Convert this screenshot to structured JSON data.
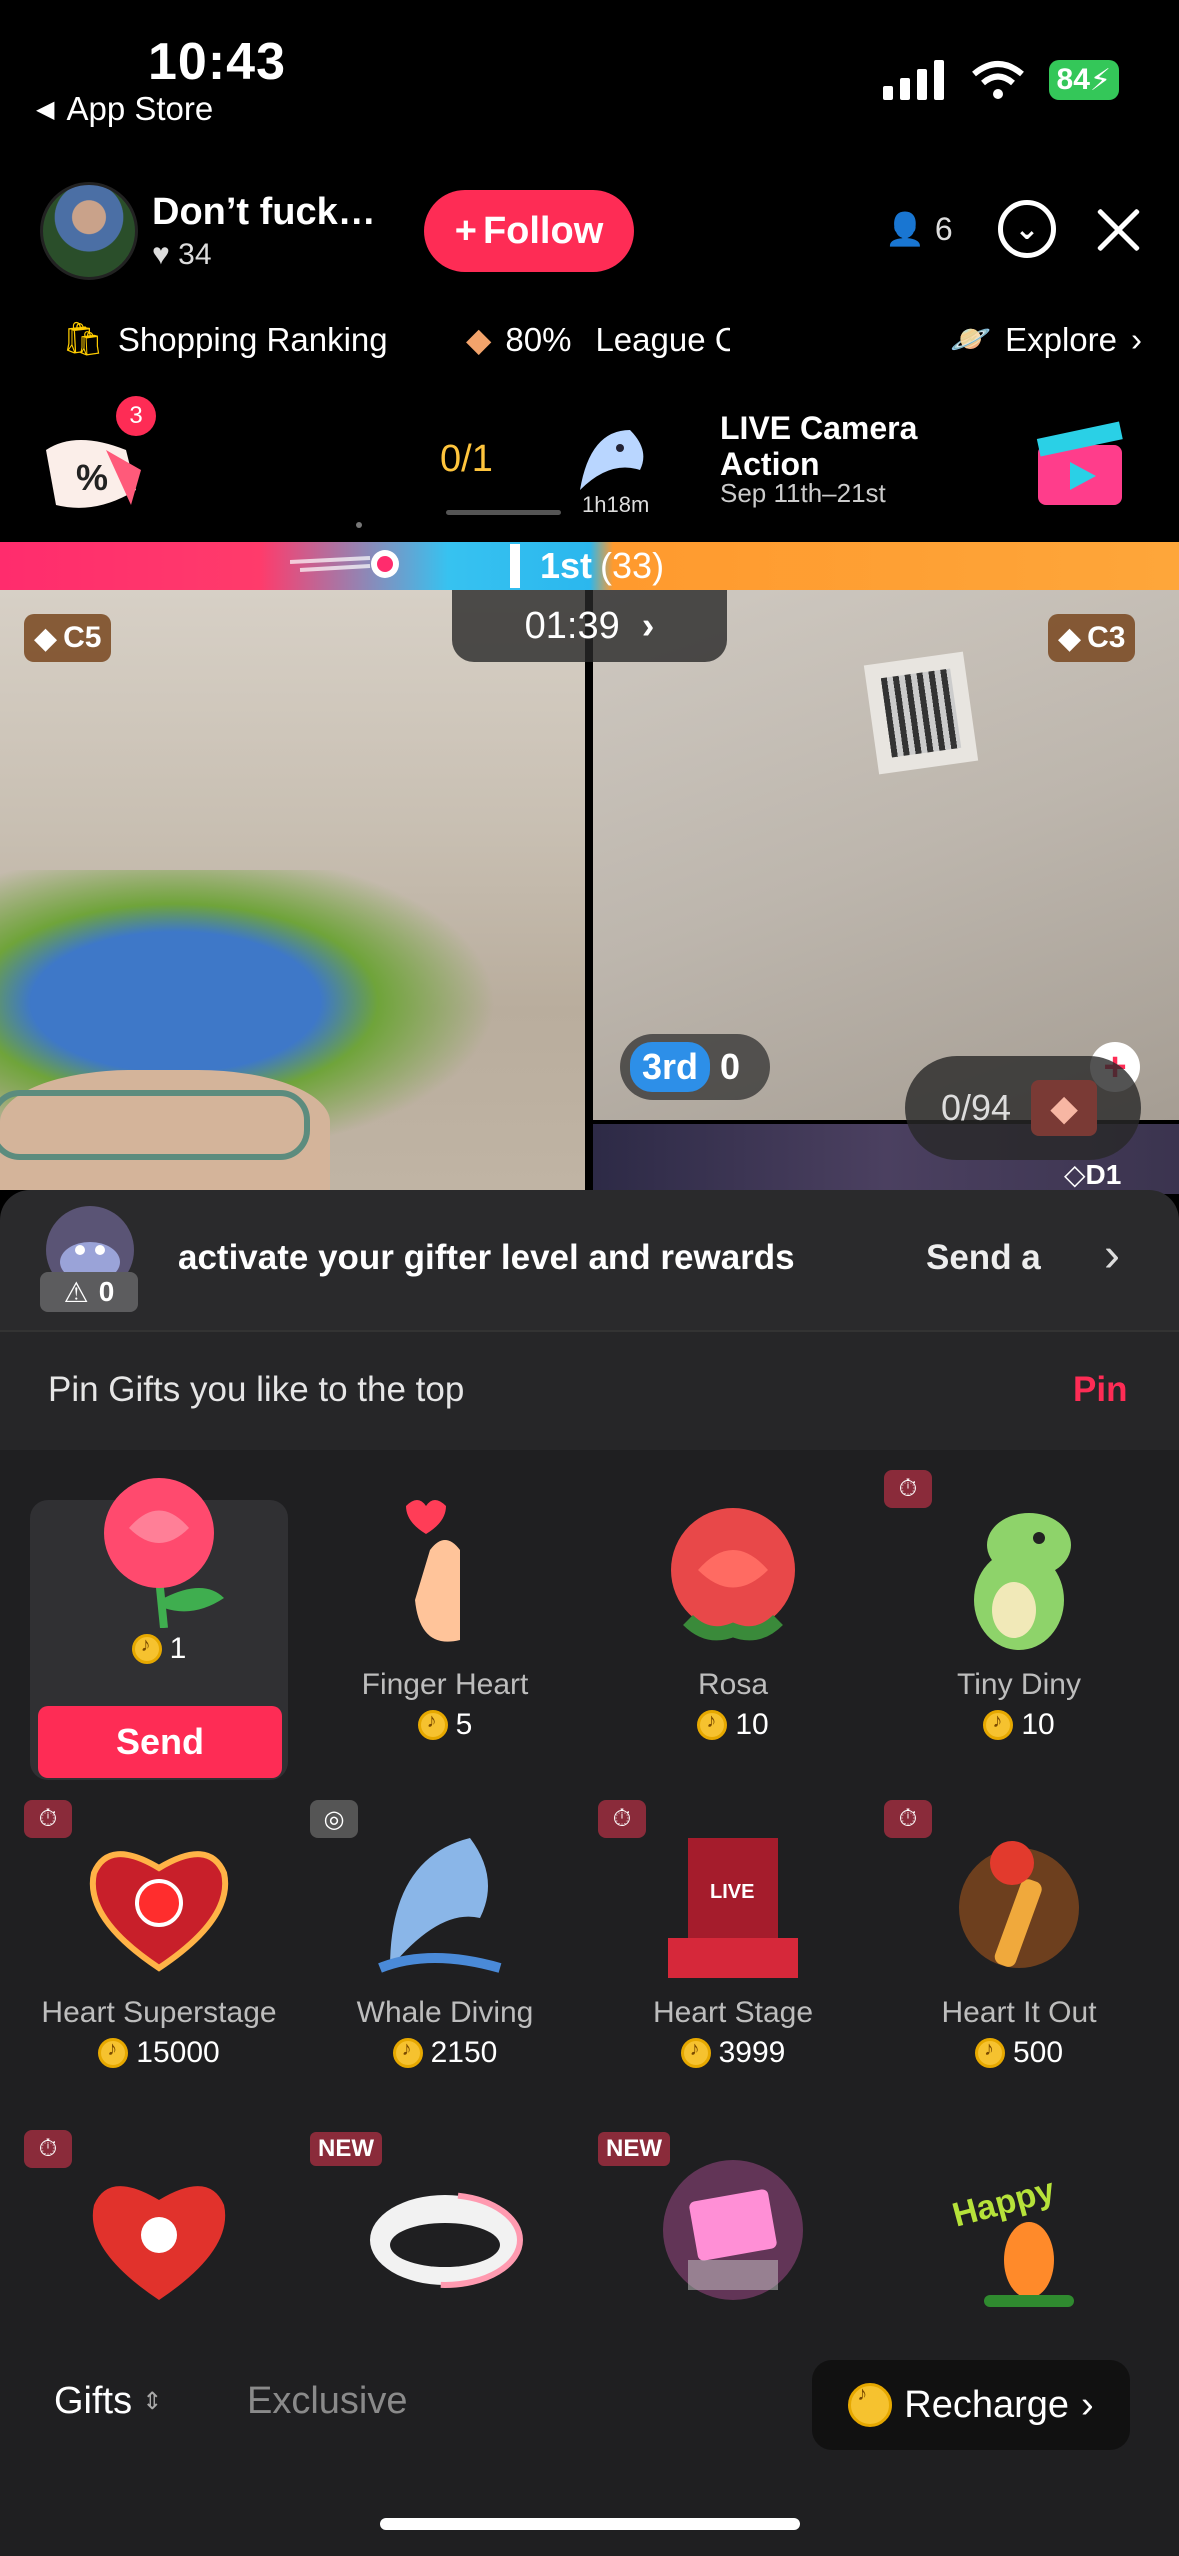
{
  "status_bar": {
    "time": "10:43",
    "back_label": "App Store",
    "battery": "84"
  },
  "host": {
    "name": "Don’t fuck…",
    "likes": "34",
    "follow_label": "Follow",
    "viewers": "6"
  },
  "info_row": {
    "shopping": "Shopping Ranking",
    "league_pct": "80%",
    "league": "League C",
    "explore": "Explore"
  },
  "promo": {
    "discount_badge": "3",
    "progress": "0/1",
    "time_left": "1h18m",
    "event_title": "LIVE Camera Action",
    "event_dates": "Sep 11th–21st"
  },
  "battle": {
    "banner_rank": "1st",
    "banner_score": "(33)",
    "timer": "01:39",
    "left_tier": "C5",
    "right_tier": "C3",
    "right_rank": "3rd",
    "right_score": "0",
    "goal": "0/94",
    "bottom_tier": "D1"
  },
  "gifter": {
    "level": "0",
    "text": "activate your gifter level and rewards",
    "send_a": "Send a"
  },
  "pin": {
    "text": "Pin Gifts you like to the top",
    "button": "Pin"
  },
  "gifts": [
    {
      "name": "Rose",
      "price": "1",
      "selected": true,
      "send_label": "Send"
    },
    {
      "name": "Finger Heart",
      "price": "5"
    },
    {
      "name": "Rosa",
      "price": "10"
    },
    {
      "name": "Tiny Diny",
      "price": "10"
    },
    {
      "name": "Heart Superstage",
      "price": "15000"
    },
    {
      "name": "Whale Diving",
      "price": "2150"
    },
    {
      "name": "Heart Stage",
      "price": "3999"
    },
    {
      "name": "Heart It Out",
      "price": "500"
    }
  ],
  "badges": {
    "new": "NEW"
  },
  "bottom": {
    "tab_gifts": "Gifts",
    "tab_exclusive": "Exclusive",
    "recharge": "Recharge"
  },
  "colors": {
    "accent": "#fe2c55",
    "panel": "#2a2a2c",
    "coin": "#f6c22f"
  }
}
